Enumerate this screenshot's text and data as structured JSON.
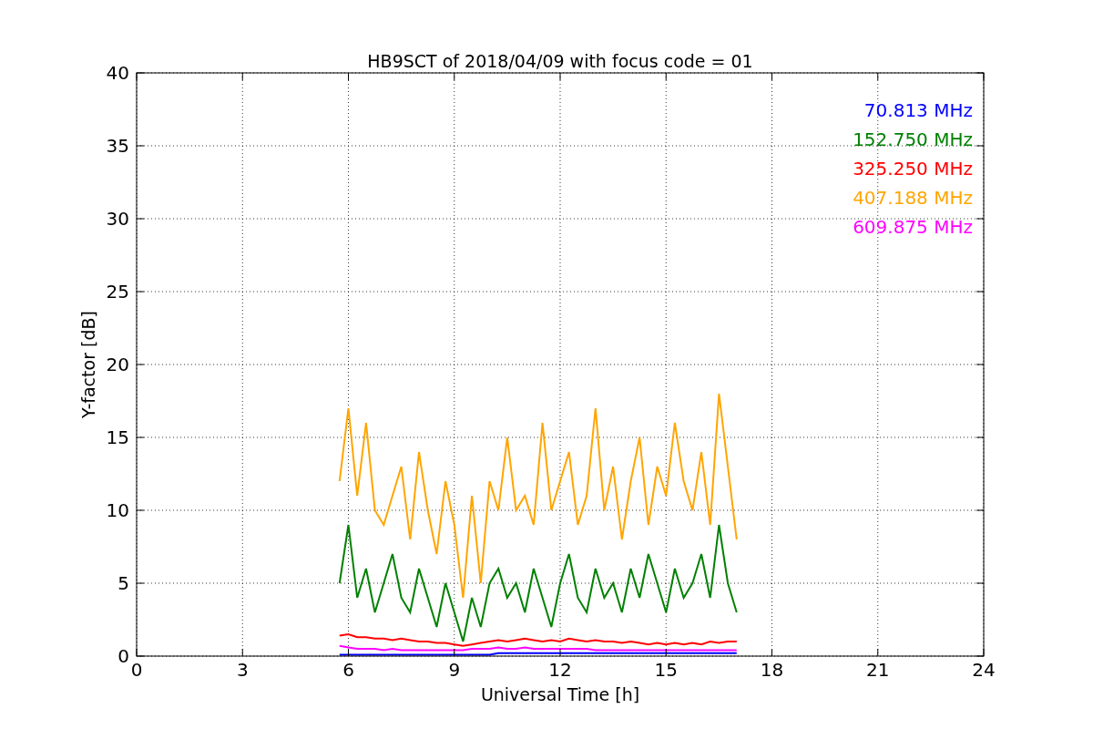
{
  "chart_data": {
    "type": "line",
    "title": "HB9SCT of 2018/04/09 with focus code = 01",
    "xlabel": "Universal Time [h]",
    "ylabel": "Y-factor [dB]",
    "x": [
      5.75,
      6,
      6.25,
      6.5,
      6.75,
      7,
      7.25,
      7.5,
      7.75,
      8,
      8.25,
      8.5,
      8.75,
      9,
      9.25,
      9.5,
      9.75,
      10,
      10.25,
      10.5,
      10.75,
      11,
      11.25,
      11.5,
      11.75,
      12,
      12.25,
      12.5,
      12.75,
      13,
      13.25,
      13.5,
      13.75,
      14,
      14.25,
      14.5,
      14.75,
      15,
      15.25,
      15.5,
      15.75,
      16,
      16.25,
      16.5,
      16.75,
      17
    ],
    "series": [
      {
        "name": "70.813 MHz",
        "color": "#0000ff",
        "values": [
          0.1,
          0.1,
          0.1,
          0.1,
          0.1,
          0.1,
          0.1,
          0.1,
          0.1,
          0.1,
          0.1,
          0.1,
          0.1,
          0.1,
          0.1,
          0.1,
          0.1,
          0.1,
          0.2,
          0.2,
          0.2,
          0.2,
          0.2,
          0.2,
          0.2,
          0.2,
          0.2,
          0.2,
          0.2,
          0.2,
          0.2,
          0.2,
          0.2,
          0.2,
          0.2,
          0.2,
          0.2,
          0.2,
          0.2,
          0.2,
          0.2,
          0.2,
          0.2,
          0.2,
          0.2,
          0.2
        ]
      },
      {
        "name": "152.750 MHz",
        "color": "#008000",
        "values": [
          5,
          9,
          4,
          6,
          3,
          5,
          7,
          4,
          3,
          6,
          4,
          2,
          5,
          3,
          1,
          4,
          2,
          5,
          6,
          4,
          5,
          3,
          6,
          4,
          2,
          5,
          7,
          4,
          3,
          6,
          4,
          5,
          3,
          6,
          4,
          7,
          5,
          3,
          6,
          4,
          5,
          7,
          4,
          9,
          5,
          3
        ]
      },
      {
        "name": "325.250 MHz",
        "color": "#ff0000",
        "values": [
          1.4,
          1.5,
          1.3,
          1.3,
          1.2,
          1.2,
          1.1,
          1.2,
          1.1,
          1.0,
          1.0,
          0.9,
          0.9,
          0.8,
          0.7,
          0.8,
          0.9,
          1.0,
          1.1,
          1.0,
          1.1,
          1.2,
          1.1,
          1.0,
          1.1,
          1.0,
          1.2,
          1.1,
          1.0,
          1.1,
          1.0,
          1.0,
          0.9,
          1.0,
          0.9,
          0.8,
          0.9,
          0.8,
          0.9,
          0.8,
          0.9,
          0.8,
          1.0,
          0.9,
          1.0,
          1.0
        ]
      },
      {
        "name": "407.188 MHz",
        "color": "#ffa500",
        "values": [
          12,
          17,
          11,
          16,
          10,
          9,
          11,
          13,
          8,
          14,
          10,
          7,
          12,
          9,
          4,
          11,
          5,
          12,
          10,
          15,
          10,
          11,
          9,
          16,
          10,
          12,
          14,
          9,
          11,
          17,
          10,
          13,
          8,
          12,
          15,
          9,
          13,
          11,
          16,
          12,
          10,
          14,
          9,
          18,
          13,
          8
        ]
      },
      {
        "name": "609.875 MHz",
        "color": "#ff00ff",
        "values": [
          0.7,
          0.6,
          0.5,
          0.5,
          0.5,
          0.4,
          0.5,
          0.4,
          0.4,
          0.4,
          0.4,
          0.4,
          0.4,
          0.4,
          0.4,
          0.5,
          0.5,
          0.5,
          0.6,
          0.5,
          0.5,
          0.6,
          0.5,
          0.5,
          0.5,
          0.5,
          0.5,
          0.5,
          0.5,
          0.4,
          0.4,
          0.4,
          0.4,
          0.4,
          0.4,
          0.4,
          0.4,
          0.4,
          0.4,
          0.4,
          0.4,
          0.4,
          0.4,
          0.4,
          0.4,
          0.4
        ]
      }
    ],
    "grid": true,
    "xlim": [
      0,
      24
    ],
    "ylim": [
      0,
      40
    ],
    "xticks": [
      0,
      3,
      6,
      9,
      12,
      15,
      18,
      21,
      24
    ],
    "yticks": [
      0,
      5,
      10,
      15,
      20,
      25,
      30,
      35,
      40
    ]
  }
}
